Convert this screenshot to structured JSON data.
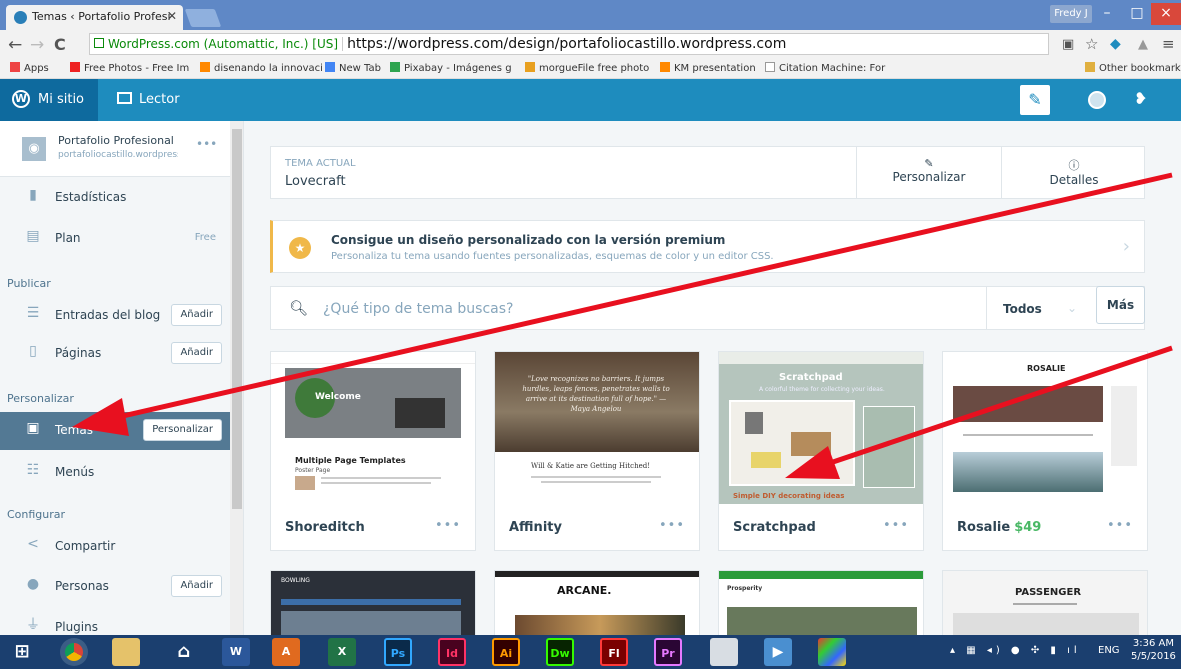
{
  "browser": {
    "tab_title": "Temas ‹ Portafolio Profesi",
    "user": "Fredy J",
    "minimize": "–",
    "maximize": "□",
    "close": "×",
    "secure_label": "WordPress.com (Automattic, Inc.) [US]",
    "url": "https://wordpress.com/design/portafoliocastillo.wordpress.com",
    "bookmarks": [
      {
        "label": "Apps",
        "color": "#e44"
      },
      {
        "label": "Free Photos - Free Im",
        "color": "#e22"
      },
      {
        "label": "disenando la innovaci",
        "color": "#f80"
      },
      {
        "label": "New Tab",
        "color": "#4285f4"
      },
      {
        "label": "Pixabay - Imágenes g",
        "color": "#2ea44f"
      },
      {
        "label": "morgueFile free photo",
        "color": "#333"
      },
      {
        "label": "KM presentation",
        "color": "#f80"
      },
      {
        "label": "Citation Machine: For",
        "color": "#999"
      },
      {
        "label": "Other bookmarks",
        "color": "#e0b040"
      }
    ]
  },
  "masterbar": {
    "my_site": "Mi sitio",
    "reader": "Lector"
  },
  "sidebar": {
    "site_name": "Portafolio Profesional",
    "site_url": "portafoliocastillo.wordpress",
    "stats": "Estadísticas",
    "plan": "Plan",
    "plan_badge": "Free",
    "publish_header": "Publicar",
    "posts": "Entradas del blog",
    "pages": "Páginas",
    "add": "Añadir",
    "personalize_header": "Personalizar",
    "themes": "Temas",
    "themes_button": "Personalizar",
    "menus": "Menús",
    "configure_header": "Configurar",
    "share": "Compartir",
    "people": "Personas",
    "plugins": "Plugins"
  },
  "main": {
    "current_theme_label": "TEMA ACTUAL",
    "current_theme": "Lovecraft",
    "customize": "Personalizar",
    "details": "Detalles",
    "upgrade_title": "Consigue un diseño personalizado con la versión premium",
    "upgrade_sub": "Personaliza tu tema usando fuentes personalizadas, esquemas de color y un editor CSS.",
    "search_placeholder": "¿Qué tipo de tema buscas?",
    "filter": "Todos",
    "more": "Más",
    "themes": [
      {
        "name": "Shoreditch",
        "price": "",
        "heading": "Welcome",
        "caption": "Multiple Page Templates",
        "caption2": "Poster Page"
      },
      {
        "name": "Affinity",
        "price": "",
        "quote": "\"Love recognizes no barriers. It jumps hurdles, leaps fences, penetrates walls to arrive at its destination full of hope.\" — Maya Angelou",
        "caption": "Will & Katie are Getting Hitched!"
      },
      {
        "name": "Scratchpad",
        "price": "",
        "heading": "Scratchpad",
        "sub": "A colorful theme for collecting your ideas.",
        "caption": "Simple DIY decorating ideas"
      },
      {
        "name": "Rosalie",
        "price": "$49",
        "heading": "ROSALIE"
      }
    ],
    "row2": [
      {
        "heading": "BOWLING"
      },
      {
        "heading": "ARCANE."
      },
      {
        "heading": "Prosperity"
      },
      {
        "heading": "PASSENGER"
      }
    ]
  },
  "taskbar": {
    "apps": [
      "Ps",
      "Id",
      "Ai",
      "Dw",
      "Fl",
      "Pr"
    ],
    "lang": "ENG",
    "time": "3:36 AM",
    "date": "5/5/2016"
  }
}
